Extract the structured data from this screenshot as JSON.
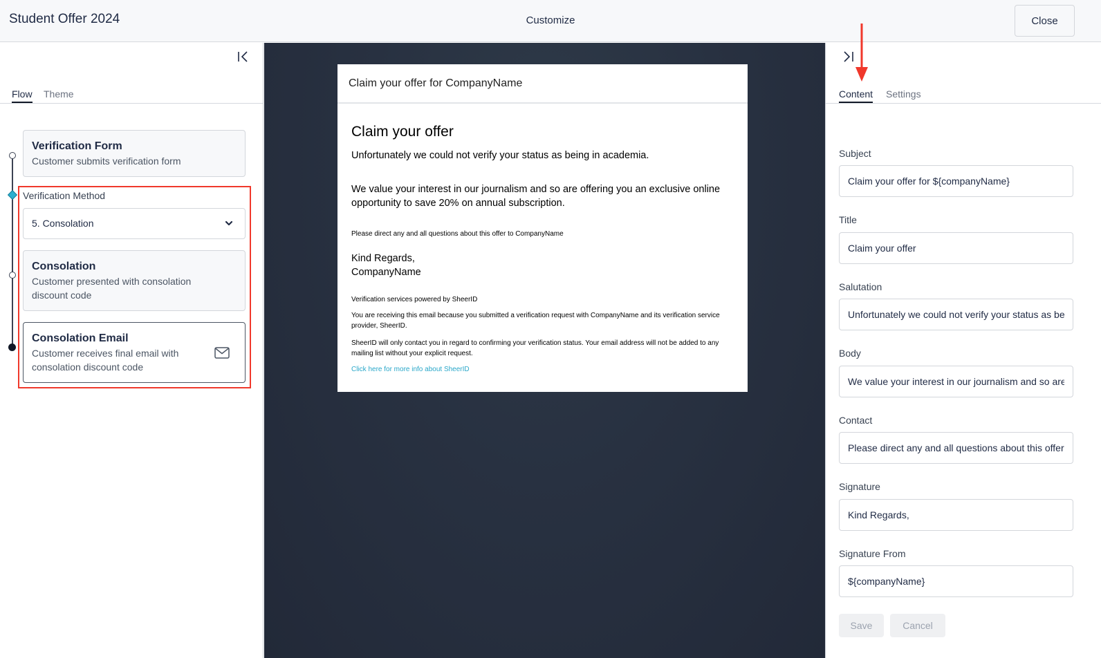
{
  "header": {
    "app_title": "Student Offer 2024",
    "center_title": "Customize",
    "close_label": "Close"
  },
  "left_panel": {
    "collapse_icon": "collapse-left-icon",
    "tabs": [
      {
        "label": "Flow",
        "active": true
      },
      {
        "label": "Theme",
        "active": false
      }
    ],
    "steps": [
      {
        "title": "Verification Form",
        "description": "Customer submits verification form"
      },
      {
        "title": "Consolation",
        "description": "Customer presented with consolation discount code"
      },
      {
        "title": "Consolation Email",
        "description": "Customer receives final email with consolation discount code",
        "icon": "mail-icon"
      }
    ],
    "verification_method": {
      "label": "Verification Method",
      "selected": "5. Consolation"
    },
    "highlight_color": "#f0382b"
  },
  "preview": {
    "subject": "Claim your offer for CompanyName",
    "title": "Claim your offer",
    "salutation": "Unfortunately we could not verify your status as being in academia.",
    "body": "We value your interest in our journalism and so are offering you an exclusive online opportunity to save 20% on annual subscription.",
    "contact": "Please direct any and all questions about this offer to CompanyName",
    "signature": "Kind Regards,",
    "signature_from": "CompanyName",
    "powered_by": "Verification services powered by SheerID",
    "notice_1": "You are receiving this email because you submitted a verification request with CompanyName and its verification service provider, SheerID.",
    "notice_2": "SheerID will only contact you in regard to confirming your verification status. Your email address will not be added to any mailing list without your explicit request.",
    "link_text": "Click here for more info about SheerID",
    "link_color": "#29a7c9"
  },
  "right_panel": {
    "collapse_icon": "collapse-right-icon",
    "tabs": [
      {
        "label": "Content",
        "active": true
      },
      {
        "label": "Settings",
        "active": false
      }
    ],
    "fields": [
      {
        "label": "Subject",
        "value": "Claim your offer for ${companyName}"
      },
      {
        "label": "Title",
        "value": "Claim your offer"
      },
      {
        "label": "Salutation",
        "value": "Unfortunately we could not verify your status as being in academia."
      },
      {
        "label": "Body",
        "value": "We value your interest in our journalism and so are offering you an exclusive online opportunity to save 20% on annual subscription."
      },
      {
        "label": "Contact",
        "value": "Please direct any and all questions about this offer to ${companyName}"
      },
      {
        "label": "Signature",
        "value": "Kind Regards,"
      },
      {
        "label": "Signature From",
        "value": "${companyName}"
      }
    ],
    "save_label": "Save",
    "cancel_label": "Cancel",
    "annotation_arrow_color": "#f0382b"
  }
}
